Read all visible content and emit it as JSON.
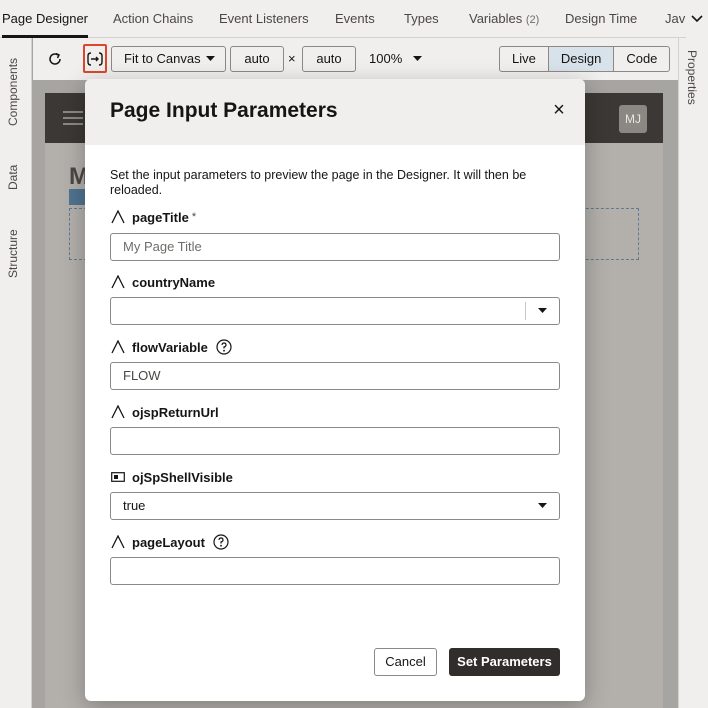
{
  "tabs": [
    {
      "label": "Page Designer"
    },
    {
      "label": "Action Chains"
    },
    {
      "label": "Event Listeners"
    },
    {
      "label": "Events"
    },
    {
      "label": "Types"
    },
    {
      "label": "Variables",
      "count": "(2)"
    },
    {
      "label": "Design Time"
    },
    {
      "label": "Jav"
    }
  ],
  "left_rail": [
    "Components",
    "Data",
    "Structure"
  ],
  "right_rail": [
    "Properties"
  ],
  "toolbar": {
    "fit_label": "Fit to Canvas",
    "width_value": "auto",
    "times": "×",
    "height_value": "auto",
    "zoom": "100%",
    "modes": [
      "Live",
      "Design",
      "Code"
    ],
    "active_mode": "Design"
  },
  "canvas": {
    "avatar": "MJ",
    "page_initial": "M"
  },
  "modal": {
    "title": "Page Input Parameters",
    "close": "×",
    "description": "Set the input parameters to preview the page in the Designer. It will then be reloaded.",
    "fields": [
      {
        "label": "pageTitle",
        "required": "*",
        "placeholder": "My Page Title",
        "value": ""
      },
      {
        "label": "countryName",
        "value": ""
      },
      {
        "label": "flowVariable",
        "value": "FLOW"
      },
      {
        "label": "ojspReturnUrl",
        "value": ""
      },
      {
        "label": "ojSpShellVisible",
        "value": "true"
      },
      {
        "label": "pageLayout",
        "value": ""
      }
    ],
    "cancel_label": "Cancel",
    "submit_label": "Set Parameters"
  }
}
